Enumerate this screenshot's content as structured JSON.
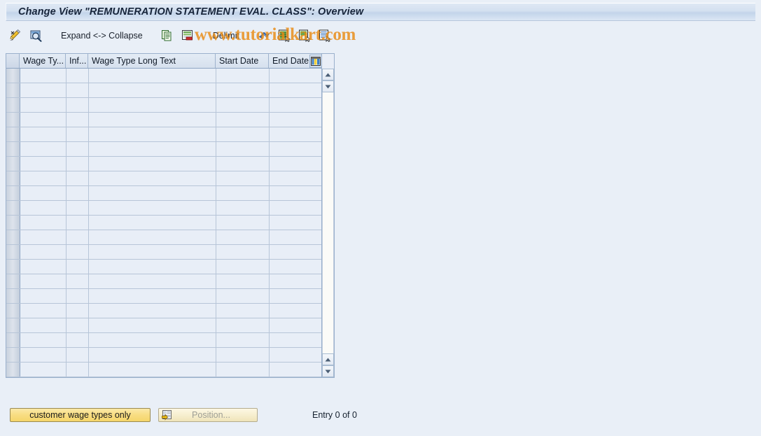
{
  "window": {
    "title": "Change View \"REMUNERATION STATEMENT EVAL. CLASS\": Overview"
  },
  "watermark": {
    "text": "www.tutorialkart.com",
    "color": "#e98b12"
  },
  "toolbar": {
    "items": [
      {
        "name": "display-change-icon",
        "type": "icon",
        "label": ""
      },
      {
        "name": "display-detail-icon",
        "type": "icon",
        "label": ""
      },
      {
        "name": "expand-collapse-button",
        "type": "text",
        "label": "Expand <-> Collapse"
      },
      {
        "name": "copy-as-icon",
        "type": "icon",
        "label": ""
      },
      {
        "name": "delete-row-icon",
        "type": "icon",
        "label": ""
      },
      {
        "name": "delimit-button",
        "type": "text",
        "label": "Delimit"
      },
      {
        "name": "undo-icon",
        "type": "icon",
        "label": ""
      },
      {
        "name": "select-all-icon",
        "type": "icon",
        "label": ""
      },
      {
        "name": "select-block-icon",
        "type": "icon",
        "label": ""
      },
      {
        "name": "deselect-all-icon",
        "type": "icon",
        "label": ""
      }
    ]
  },
  "table": {
    "columns": [
      {
        "key": "wage_type",
        "label": "Wage Ty..."
      },
      {
        "key": "infotype",
        "label": "Inf..."
      },
      {
        "key": "wage_type_long_text",
        "label": "Wage Type Long Text"
      },
      {
        "key": "start_date",
        "label": "Start Date"
      },
      {
        "key": "end_date",
        "label": "End Date"
      }
    ],
    "rows": [],
    "empty_row_count": 21,
    "column_config_icon": "column-configuration-icon"
  },
  "scrollbar": {
    "up_arrow": "scroll-up-icon",
    "down_arrow": "scroll-down-icon",
    "page_up_arrow": "page-up-icon",
    "page_down_arrow": "page-down-icon"
  },
  "footer": {
    "customer_wage_types_button": "customer wage types only",
    "position_button": "Position...",
    "position_icon": "position-find-icon",
    "entry_status": "Entry 0 of 0"
  }
}
